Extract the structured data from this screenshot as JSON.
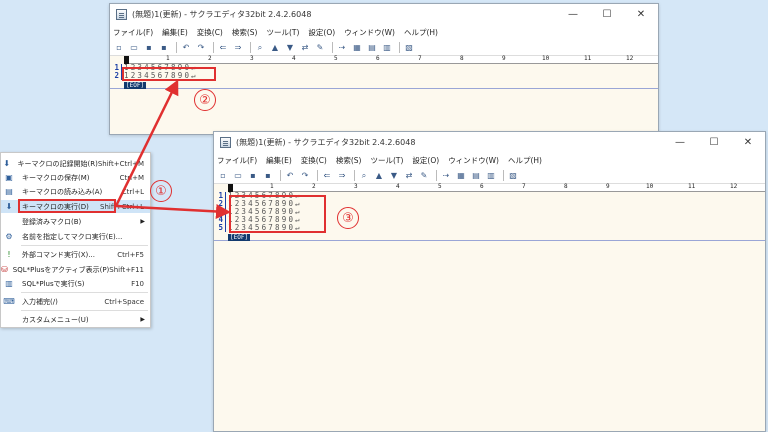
{
  "window1": {
    "title": "(無題)1(更新) - サクラエディタ32bit 2.4.2.6048",
    "controls": [
      "—",
      "☐",
      "✕"
    ],
    "menu": [
      "ファイル(F)",
      "編集(E)",
      "変換(C)",
      "検索(S)",
      "ツール(T)",
      "設定(O)",
      "ウィンドウ(W)",
      "ヘルプ(H)"
    ],
    "lines": [
      {
        "num": "1",
        "text": "1234567890↵"
      },
      {
        "num": "2",
        "text": "1234567890↵"
      }
    ],
    "eof": "[EOF]"
  },
  "window2": {
    "title": "(無題)1(更新) - サクラエディタ32bit 2.4.2.6048",
    "controls": [
      "—",
      "☐",
      "✕"
    ],
    "menu": [
      "ファイル(F)",
      "編集(E)",
      "変換(C)",
      "検索(S)",
      "ツール(T)",
      "設定(O)",
      "ウィンドウ(W)",
      "ヘルプ(H)"
    ],
    "lines": [
      {
        "num": "1",
        "text": "1234567890↵"
      },
      {
        "num": "2",
        "text": "1234567890↵"
      },
      {
        "num": "3",
        "text": "1234567890↵"
      },
      {
        "num": "4",
        "text": "1234567890↵"
      },
      {
        "num": "5",
        "text": "1234567890↵"
      }
    ],
    "eof": "[EOF]"
  },
  "ruler_labels": [
    "1",
    "2",
    "3",
    "4",
    "5",
    "6",
    "7",
    "8",
    "9",
    "10",
    "11",
    "12"
  ],
  "context_menu": {
    "items": [
      {
        "label": "キーマクロの記録開始(R)",
        "shortcut": "Shift+Ctrl+M",
        "icon": "record-icon"
      },
      {
        "label": "キーマクロの保存(M)",
        "shortcut": "Ctrl+M",
        "icon": "save-icon"
      },
      {
        "label": "キーマクロの読み込み(A)",
        "shortcut": "Ctrl+L",
        "icon": "load-icon"
      },
      {
        "label": "キーマクロの実行(D)",
        "shortcut": "Shift+Ctrl+L",
        "icon": "run-icon"
      },
      {
        "label": "登録済みマクロ(B)",
        "shortcut": "",
        "icon": ""
      },
      {
        "label": "名前を指定してマクロ実行(E)...",
        "shortcut": "",
        "icon": "named-run-icon"
      },
      {
        "label": "外部コマンド実行(X)...",
        "shortcut": "Ctrl+F5",
        "icon": "exclamation-icon"
      },
      {
        "label": "SQL*Plusをアクティブ表示(P)",
        "shortcut": "Shift+F11",
        "icon": "sqlplus-icon"
      },
      {
        "label": "SQL*Plusで実行(S)",
        "shortcut": "F10",
        "icon": "sqlplus-run-icon"
      },
      {
        "label": "入力補完(/)",
        "shortcut": "Ctrl+Space",
        "icon": "complete-icon"
      },
      {
        "label": "カスタムメニュー(U)",
        "shortcut": "",
        "icon": ""
      }
    ]
  },
  "callouts": [
    "①",
    "②",
    "③"
  ],
  "colors": {
    "highlight": "#e03030",
    "background": "#d5e7f7",
    "editor": "#fdf9ee",
    "line_number": "#1b3fa6"
  }
}
